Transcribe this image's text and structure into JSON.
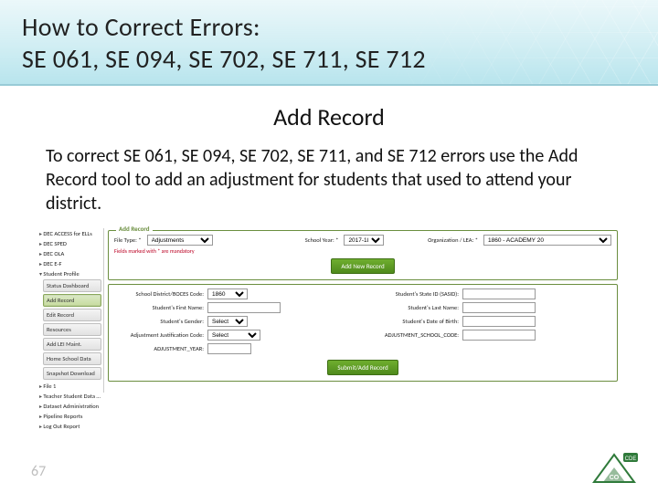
{
  "title": {
    "line1": "How to Correct Errors:",
    "line2": "SE 061, SE 094, SE 702, SE 711, SE 712"
  },
  "section_heading": "Add Record",
  "paragraph": "To correct SE 061, SE 094, SE 702, SE 711, and SE 712 errors use the Add Record tool to add an adjustment for students that used to attend your district.",
  "sidebar": {
    "groups": [
      {
        "label": "DEC ACCESS for ELLs",
        "open": false
      },
      {
        "label": "DEC SPED",
        "open": false
      },
      {
        "label": "DEC OLA",
        "open": false
      },
      {
        "label": "DEC E-F",
        "open": false
      },
      {
        "label": "Student Profile",
        "open": true,
        "items": [
          {
            "label": "Status Dashboard",
            "active": false
          },
          {
            "label": "Add Record",
            "active": true
          },
          {
            "label": "Edit Record",
            "active": false
          },
          {
            "label": "Resources",
            "active": false
          },
          {
            "label": "Add LEI Maint.",
            "active": false
          },
          {
            "label": "Home School Data",
            "active": false
          },
          {
            "label": "Snapshot Download",
            "active": false
          }
        ]
      },
      {
        "label": "File 1",
        "open": false
      },
      {
        "label": "Teacher Student Data Link",
        "open": false
      },
      {
        "label": "Dataset Administration",
        "open": false
      },
      {
        "label": "Pipeline Reports",
        "open": false
      },
      {
        "label": "Log Out Report",
        "open": false
      }
    ]
  },
  "form": {
    "legend": "Add Record",
    "file_type_label": "File Type: *",
    "file_type_value": "Adjustments",
    "school_year_label": "School Year: *",
    "school_year_value": "2017-18",
    "organization_label": "Organization / LEA: *",
    "organization_value": "1860 - ACADEMY 20",
    "mandatory_hint": "Fields marked with * are mandatory",
    "new_button": "Add New Record",
    "fields": {
      "district_code": {
        "label": "School District/BOCES Code:",
        "value": "1860"
      },
      "state_id": {
        "label": "Student's State ID (SASID):",
        "value": ""
      },
      "first_name": {
        "label": "Student's First Name:",
        "value": ""
      },
      "last_name": {
        "label": "Student's Last Name:",
        "value": ""
      },
      "gender": {
        "label": "Student's Gender:",
        "value": "Select"
      },
      "dob": {
        "label": "Student's Date of Birth:",
        "value": ""
      },
      "adj_code": {
        "label": "Adjustment Justification Code:",
        "value": "Select"
      },
      "adj_school": {
        "label": "ADJUSTMENT_SCHOOL_CODE:",
        "value": ""
      },
      "adj_year": {
        "label": "ADJUSTMENT_YEAR:",
        "value": ""
      }
    },
    "submit_button": "Submit/Add Record"
  },
  "page_number": "67"
}
